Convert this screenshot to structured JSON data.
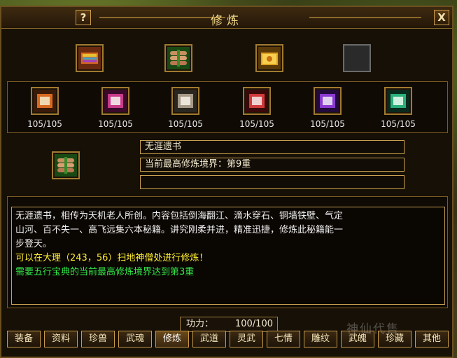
{
  "window": {
    "title": "修炼",
    "help_label": "?",
    "close_label": "X"
  },
  "top_slots": [
    {
      "icon": "rainbow-book-icon",
      "color": "#c84a20"
    },
    {
      "icon": "scroll-bundle-icon",
      "color": "#3a8a2a"
    },
    {
      "icon": "gold-book-icon",
      "color": "#d89a20"
    },
    {
      "icon": "empty-slot-icon",
      "color": "#444444"
    }
  ],
  "skill_slots": [
    {
      "icon": "orange-scroll-icon",
      "color": "#d86a20",
      "count": "105/105"
    },
    {
      "icon": "pink-scroll-icon",
      "color": "#c83a8a",
      "count": "105/105"
    },
    {
      "icon": "silver-scroll-icon",
      "color": "#a89a88",
      "count": "105/105"
    },
    {
      "icon": "red-scroll-icon",
      "color": "#d03a3a",
      "count": "105/105"
    },
    {
      "icon": "purple-scroll-icon",
      "color": "#8a3ad0",
      "count": "105/105"
    },
    {
      "icon": "green-scroll-icon",
      "color": "#2ab07a",
      "count": "105/105"
    }
  ],
  "selected": {
    "icon": "scroll-bundle-icon",
    "name": "无涯遗书",
    "realm": "当前最高修炼境界：第9重",
    "extra": ""
  },
  "description": {
    "line1": "无涯遗书，相传为天机老人所创。内容包括倒海翻江、滴水穿石、铜墙铁壁、气定",
    "line2": "山河、百不失一、高飞远集六本秘籍。讲究刚柔并进，精准迅捷，修炼此秘籍能一",
    "line3": "步登天。",
    "location": "可以在大理（243，56）扫地神僧处进行修炼！",
    "requirement": "需要五行宝典的当前最高修炼境界达到第3重"
  },
  "power": {
    "label": "功力：",
    "value": "100/100"
  },
  "tabs": [
    "装备",
    "资料",
    "珍兽",
    "武魂",
    "修炼",
    "武道",
    "灵武",
    "七情",
    "雕纹",
    "武魄",
    "珍藏",
    "其他"
  ],
  "active_tab": "修炼",
  "watermark": "神仙代售"
}
